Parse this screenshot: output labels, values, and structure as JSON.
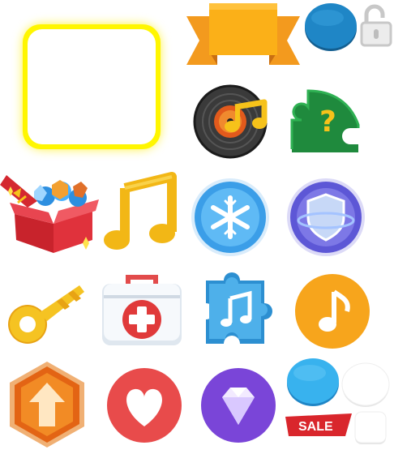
{
  "sheet": {
    "sprites": [
      {
        "name": "glow-frame-icon"
      },
      {
        "name": "ribbon-banner-icon"
      },
      {
        "name": "blue-button-icon"
      },
      {
        "name": "padlock-open-icon"
      },
      {
        "name": "vinyl-record-icon"
      },
      {
        "name": "puzzle-question-icon"
      },
      {
        "name": "gift-box-gems-icon"
      },
      {
        "name": "music-note-icon"
      },
      {
        "name": "snowflake-badge-icon"
      },
      {
        "name": "shield-badge-icon"
      },
      {
        "name": "golden-key-icon"
      },
      {
        "name": "first-aid-kit-icon"
      },
      {
        "name": "puzzle-music-icon"
      },
      {
        "name": "music-badge-icon"
      },
      {
        "name": "hexagon-arrow-icon"
      },
      {
        "name": "heart-badge-icon"
      },
      {
        "name": "diamond-badge-icon"
      },
      {
        "name": "blue-button-small-icon"
      },
      {
        "name": "white-circle-icon"
      },
      {
        "name": "sale-tag-icon"
      },
      {
        "name": "white-square-icon"
      }
    ]
  },
  "sale_tag": {
    "label": "SALE"
  },
  "colors": {
    "yellow": "#ffe600",
    "orange": "#f5a020",
    "ribbon_dark": "#e8861a",
    "blue_button": "#1f86c6",
    "green_puzzle": "#2aa044",
    "gift_red": "#e0323c",
    "heart_red": "#e84b4b",
    "diamond_purple": "#7a45d8",
    "music_orange": "#f7a51c",
    "snow_blue": "#3b9ee8",
    "shield_purple": "#5d57d6",
    "sale_red": "#d9262c"
  }
}
